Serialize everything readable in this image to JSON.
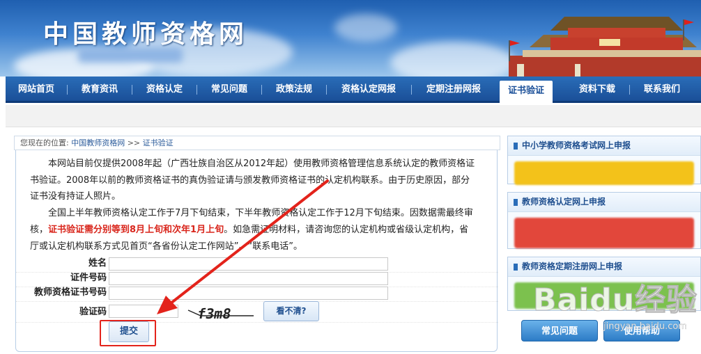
{
  "header": {
    "site_title": "中国教师资格网"
  },
  "nav": {
    "items": [
      {
        "label": "网站首页"
      },
      {
        "label": "教育资讯"
      },
      {
        "label": "资格认定"
      },
      {
        "label": "常见问题"
      },
      {
        "label": "政策法规"
      },
      {
        "label": "资格认定网报"
      },
      {
        "label": "定期注册网报"
      },
      {
        "label": "证书验证"
      },
      {
        "label": "资料下载"
      },
      {
        "label": "联系我们"
      }
    ],
    "active_index": 7
  },
  "breadcrumb": {
    "prefix": "您现在的位置:",
    "home": "中国教师资格网",
    "separator": ">>",
    "current": "证书验证"
  },
  "notice": {
    "p1": "本网站目前仅提供2008年起（广西壮族自治区从2012年起）使用教师资格管理信息系统认定的教师资格证书验证。2008年以前的教师资格证书的真伪验证请与颁发教师资格证书的认定机构联系。由于历史原因，部分证书没有持证人照片。",
    "p2_a": "全国上半年教师资格认定工作于7月下旬结束，下半年教师资格认定工作于12月下旬结束。因数据需最终审核，",
    "p2_red": "证书验证需分别等到8月上旬和次年1月上旬",
    "p2_b": "。如急需证明材料，请咨询您的认定机构或省级认定机构，省厅或认定机构联系方式见首页“各省份认定工作网站”、“联系电话”。"
  },
  "form": {
    "name_label": "姓名",
    "id_label": "证件号码",
    "cert_label": "教师资格证书号码",
    "captcha_label": "验证码",
    "name_value": "",
    "id_value": "",
    "cert_value": "",
    "captcha_value": "",
    "captcha_text": "f3m8",
    "refresh_label": "看不清?",
    "submit_label": "提交"
  },
  "sidebar": {
    "sections": [
      {
        "title": "中小学教师资格考试网上申报",
        "banner_color": "#f3c21a"
      },
      {
        "title": "教师资格认定网上申报",
        "banner_color": "#e2473b"
      },
      {
        "title": "教师资格定期注册网上申报",
        "banner_color": "#7cc14e"
      }
    ],
    "buttons": [
      {
        "label": "常见问题"
      },
      {
        "label": "使用帮助"
      }
    ]
  },
  "watermark": {
    "brand": "Baidu经验",
    "url": "jingyan.baidu.com"
  },
  "colors": {
    "nav_bg": "#1a4f98",
    "accent": "#2a6db8",
    "highlight_red": "#e3231b"
  }
}
